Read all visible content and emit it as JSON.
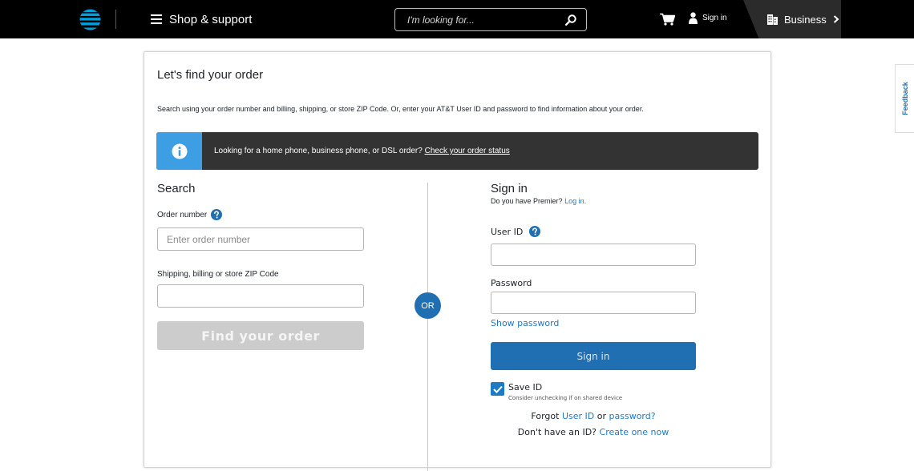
{
  "header": {
    "menu_label": "Shop & support",
    "search_placeholder": "I'm looking for...",
    "signin_label": "Sign in",
    "business_label": "Business"
  },
  "feedback_label": "Feedback",
  "page": {
    "title": "Let's find your order",
    "intro": "Search using your order number and billing, shipping, or store ZIP Code. Or, enter your AT&T User ID and password to find information about your order.",
    "info_text": "Looking for a home phone, business phone, or DSL order?",
    "info_link": "Check your order status"
  },
  "search": {
    "title": "Search",
    "order_label": "Order number",
    "order_placeholder": "Enter order number",
    "zip_label": "Shipping, billing or store ZIP Code",
    "zip_value": "",
    "find_button": "Find your order"
  },
  "or_label": "OR",
  "signin": {
    "title": "Sign in",
    "premier_prefix": "Do you have Premier?",
    "premier_link": "Log in.",
    "userid_label": "User ID",
    "userid_value": "",
    "password_label": "Password",
    "password_value": "",
    "show_password": "Show password",
    "signin_button": "Sign in",
    "save_id_label": "Save ID",
    "save_id_checked": true,
    "save_id_hint": "Consider unchecking if on shared device",
    "forgot_prefix": "Forgot",
    "forgot_userid": "User ID",
    "forgot_or": "or",
    "forgot_password": "password?",
    "no_id_text": "Don't have an ID?",
    "create_link": "Create one now"
  },
  "colors": {
    "header_bg": "#000000",
    "accent_blue": "#1f6fb2",
    "info_blue": "#3e9ee3",
    "info_bar_bg": "#333333",
    "disabled_button": "#cccccc"
  }
}
